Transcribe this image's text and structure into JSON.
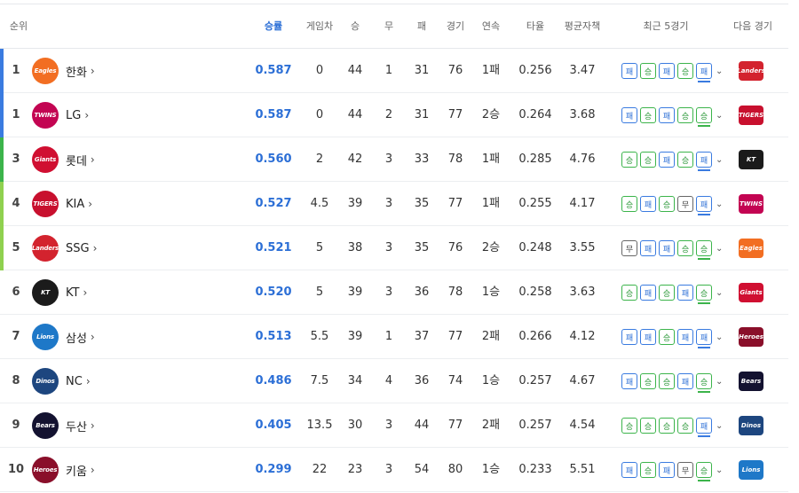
{
  "headers": {
    "rank": "순위",
    "win_pct": "승률",
    "games_behind": "게임차",
    "wins": "승",
    "draws": "무",
    "losses": "패",
    "games": "경기",
    "streak": "연속",
    "batting_avg": "타율",
    "era": "평균자책",
    "recent5": "최근 5경기",
    "next_game": "다음 경기"
  },
  "colors": {
    "accent": "#2c6fd6",
    "win": "#3cb44b",
    "loss": "#3a7be0",
    "bar_top": "#3a7be0",
    "bar_mid": "#3cb44b",
    "bar_low": "#8fd14f"
  },
  "result_labels": {
    "w": "승",
    "l": "패",
    "d": "무"
  },
  "teams": [
    {
      "rank": "1",
      "name": "한화",
      "win_pct": "0.587",
      "gb": "0",
      "w": "44",
      "d": "1",
      "l": "31",
      "g": "76",
      "streak": "1패",
      "avg": "0.256",
      "era": "3.47",
      "recent": [
        "l",
        "w",
        "l",
        "w",
        "l"
      ],
      "logo_text": "Eagles",
      "logo_color": "#f26e22",
      "next_text": "Landers",
      "next_color": "#d3232e"
    },
    {
      "rank": "1",
      "name": "LG",
      "win_pct": "0.587",
      "gb": "0",
      "w": "44",
      "d": "2",
      "l": "31",
      "g": "77",
      "streak": "2승",
      "avg": "0.264",
      "era": "3.68",
      "recent": [
        "l",
        "w",
        "l",
        "w",
        "w"
      ],
      "logo_text": "TWINS",
      "logo_color": "#c30452",
      "next_text": "TIGERS",
      "next_color": "#c8102e"
    },
    {
      "rank": "3",
      "name": "롯데",
      "win_pct": "0.560",
      "gb": "2",
      "w": "42",
      "d": "3",
      "l": "33",
      "g": "78",
      "streak": "1패",
      "avg": "0.285",
      "era": "4.76",
      "recent": [
        "w",
        "w",
        "l",
        "w",
        "l"
      ],
      "logo_text": "Giants",
      "logo_color": "#d00f31",
      "next_text": "KT",
      "next_color": "#1b1b1b"
    },
    {
      "rank": "4",
      "name": "KIA",
      "win_pct": "0.527",
      "gb": "4.5",
      "w": "39",
      "d": "3",
      "l": "35",
      "g": "77",
      "streak": "1패",
      "avg": "0.255",
      "era": "4.17",
      "recent": [
        "w",
        "l",
        "w",
        "d",
        "l"
      ],
      "logo_text": "TIGERS",
      "logo_color": "#c8102e",
      "next_text": "TWINS",
      "next_color": "#c30452"
    },
    {
      "rank": "5",
      "name": "SSG",
      "win_pct": "0.521",
      "gb": "5",
      "w": "38",
      "d": "3",
      "l": "35",
      "g": "76",
      "streak": "2승",
      "avg": "0.248",
      "era": "3.55",
      "recent": [
        "d",
        "l",
        "l",
        "w",
        "w"
      ],
      "logo_text": "Landers",
      "logo_color": "#d3232e",
      "next_text": "Eagles",
      "next_color": "#f26e22"
    },
    {
      "rank": "6",
      "name": "KT",
      "win_pct": "0.520",
      "gb": "5",
      "w": "39",
      "d": "3",
      "l": "36",
      "g": "78",
      "streak": "1승",
      "avg": "0.258",
      "era": "3.63",
      "recent": [
        "w",
        "l",
        "w",
        "l",
        "w"
      ],
      "logo_text": "KT",
      "logo_color": "#1b1b1b",
      "next_text": "Giants",
      "next_color": "#d00f31"
    },
    {
      "rank": "7",
      "name": "삼성",
      "win_pct": "0.513",
      "gb": "5.5",
      "w": "39",
      "d": "1",
      "l": "37",
      "g": "77",
      "streak": "2패",
      "avg": "0.266",
      "era": "4.12",
      "recent": [
        "l",
        "l",
        "w",
        "l",
        "l"
      ],
      "logo_text": "Lions",
      "logo_color": "#1e78c8",
      "next_text": "Heroes",
      "next_color": "#8a0f2a"
    },
    {
      "rank": "8",
      "name": "NC",
      "win_pct": "0.486",
      "gb": "7.5",
      "w": "34",
      "d": "4",
      "l": "36",
      "g": "74",
      "streak": "1승",
      "avg": "0.257",
      "era": "4.67",
      "recent": [
        "l",
        "w",
        "w",
        "l",
        "w"
      ],
      "logo_text": "Dinos",
      "logo_color": "#1d467f",
      "next_text": "Bears",
      "next_color": "#131230"
    },
    {
      "rank": "9",
      "name": "두산",
      "win_pct": "0.405",
      "gb": "13.5",
      "w": "30",
      "d": "3",
      "l": "44",
      "g": "77",
      "streak": "2패",
      "avg": "0.257",
      "era": "4.54",
      "recent": [
        "w",
        "w",
        "w",
        "w",
        "l"
      ],
      "logo_text": "Bears",
      "logo_color": "#131230",
      "next_text": "Dinos",
      "next_color": "#1d467f"
    },
    {
      "rank": "10",
      "name": "키움",
      "win_pct": "0.299",
      "gb": "22",
      "w": "23",
      "d": "3",
      "l": "54",
      "g": "80",
      "streak": "1승",
      "avg": "0.233",
      "era": "5.51",
      "recent": [
        "l",
        "w",
        "l",
        "d",
        "w"
      ],
      "logo_text": "Heroes",
      "logo_color": "#8a0f2a",
      "next_text": "Lions",
      "next_color": "#1e78c8"
    }
  ]
}
